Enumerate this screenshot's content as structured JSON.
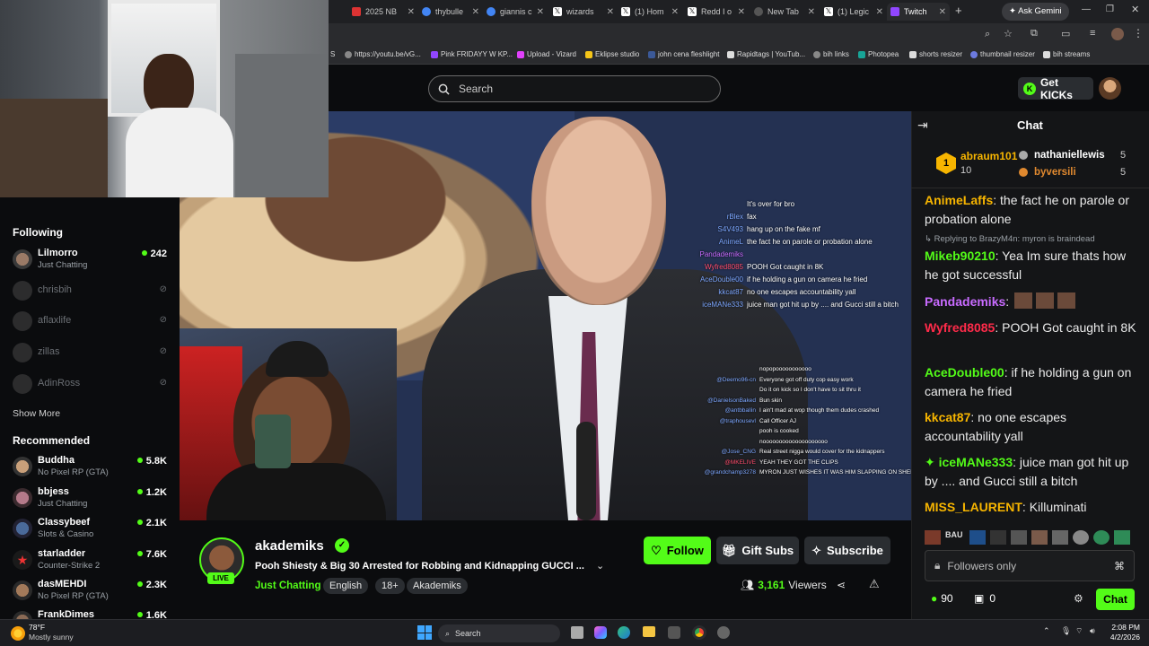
{
  "browser": {
    "tabs": [
      {
        "label": "2025 NB",
        "color": "#d33"
      },
      {
        "label": "thybulle",
        "color": "#4285f4"
      },
      {
        "label": "giannis c",
        "color": "#4285f4"
      },
      {
        "label": "wizards",
        "color": "#fff"
      },
      {
        "label": "(1) Hom",
        "color": "#fff"
      },
      {
        "label": "Redd I o",
        "color": "#fff"
      },
      {
        "label": "New Tab",
        "color": "#aaa"
      },
      {
        "label": "(1) Legic",
        "color": "#fff"
      },
      {
        "label": "Twitch",
        "color": "#9146ff"
      }
    ],
    "ask_gemini": "Ask Gemini",
    "bookmarks": [
      {
        "label": "S",
        "color": "#888"
      },
      {
        "label": "https://youtu.be/vG...",
        "color": "#888"
      },
      {
        "label": "Pink FRIDAYY W KP...",
        "color": "#9146ff"
      },
      {
        "label": "Upload - Vizard",
        "color": "#e040fb"
      },
      {
        "label": "Eklipse studio",
        "color": "#f5c518"
      },
      {
        "label": "john cena fleshlight",
        "color": "#3b5998"
      },
      {
        "label": "Rapidtags | YouTub...",
        "color": "#ddd"
      },
      {
        "label": "bih links",
        "color": "#888"
      },
      {
        "label": "Photopea",
        "color": "#18a497"
      },
      {
        "label": "shorts resizer",
        "color": "#ddd"
      },
      {
        "label": "thumbnail resizer",
        "color": "#6c7ae0"
      },
      {
        "label": "bih streams",
        "color": "#ddd"
      }
    ]
  },
  "header": {
    "search_placeholder": "Search",
    "get_kicks": "Get KICKs"
  },
  "sidebar": {
    "following_heading": "Following",
    "following": [
      {
        "name": "Lilmorro",
        "category": "Just Chatting",
        "viewers": "242",
        "live": true
      },
      {
        "name": "chrisbih",
        "live": false
      },
      {
        "name": "aflaxlife",
        "live": false
      },
      {
        "name": "zillas",
        "live": false
      },
      {
        "name": "AdinRoss",
        "live": false
      }
    ],
    "show_more": "Show More",
    "recommended_heading": "Recommended",
    "recommended": [
      {
        "name": "Buddha",
        "category": "No Pixel RP (GTA)",
        "viewers": "5.8K"
      },
      {
        "name": "bbjess",
        "category": "Just Chatting",
        "viewers": "1.2K"
      },
      {
        "name": "Classybeef",
        "category": "Slots & Casino",
        "viewers": "2.1K"
      },
      {
        "name": "starladder",
        "category": "Counter-Strike 2",
        "viewers": "7.6K"
      },
      {
        "name": "dasMEHDI",
        "category": "No Pixel RP (GTA)",
        "viewers": "2.3K"
      },
      {
        "name": "FrankDimes",
        "category": "",
        "viewers": "1.6K"
      }
    ]
  },
  "video_overlay_chat_top": [
    {
      "user": "",
      "text": "It's over for bro",
      "color": "#7da7ff"
    },
    {
      "user": "rBlex",
      "text": "fax",
      "color": "#7da7ff"
    },
    {
      "user": "S4V493",
      "text": "hang up on the fake mf",
      "color": "#7da7ff"
    },
    {
      "user": "AnimeL",
      "text": "the fact he on parole or probation alone",
      "color": "#7da7ff"
    },
    {
      "user": "Pandademiks",
      "text": "",
      "color": "#c86bff"
    },
    {
      "user": "Wyfred8085",
      "text": "POOH Got caught in 8K",
      "color": "#ff4d6d"
    },
    {
      "user": "AceDouble00",
      "text": "if he holding a gun on camera he fried",
      "color": "#7da7ff"
    },
    {
      "user": "kkcat87",
      "text": "no one escapes accountability yall",
      "color": "#7da7ff"
    },
    {
      "user": "iceMANe333",
      "text": "juice man got hit up by .... and Gucci still a bitch",
      "color": "#7da7ff"
    }
  ],
  "video_overlay_chat_bottom": [
    {
      "user": "",
      "text": "nopopooooooooooo",
      "color": "#c86bff"
    },
    {
      "user": "@Deemo96-cn",
      "text": "Everyone got off duty cop easy work",
      "color": "#7da7ff"
    },
    {
      "user": "",
      "text": "Do it on kick so I don't have to sit thru it",
      "color": "#7da7ff"
    },
    {
      "user": "@DanielsonBaked",
      "text": "Bun skin",
      "color": "#7da7ff"
    },
    {
      "user": "@antbballin",
      "text": "I ain't mad at wop though them dudes crashed",
      "color": "#7da7ff"
    },
    {
      "user": "@traphousevl",
      "text": "Call Officer AJ",
      "color": "#7da7ff"
    },
    {
      "user": "",
      "text": "pooh is cooked",
      "color": "#7da7ff"
    },
    {
      "user": "",
      "text": "noooooooooooooooooooo",
      "color": "#7da7ff"
    },
    {
      "user": "@Jose_CNG",
      "text": "Real street nigga would cover for the kidnappers",
      "color": "#7da7ff"
    },
    {
      "user": "@MKELIVE",
      "text": "YEAH THEY GOT THE CLIPS",
      "color": "#ff4d6d"
    },
    {
      "user": "@grandchamp3278",
      "text": "MYRON JUST WISHES IT WAS HIM SLAPPING ON SHEISTYS CUFFS!!!!",
      "color": "#7da7ff"
    }
  ],
  "stream": {
    "live_badge": "LIVE",
    "channel": "akademiks",
    "title": "Pooh Shiesty & Big 30 Arrested for Robbing and Kidnapping GUCCI ...",
    "category": "Just Chatting",
    "tags": [
      "English",
      "18+",
      "Akademiks"
    ],
    "follow": "Follow",
    "gift_subs": "Gift Subs",
    "subscribe": "Subscribe",
    "viewers": "3,161",
    "viewers_label": "Viewers"
  },
  "chat": {
    "title": "Chat",
    "gifters": [
      {
        "name": "abraum101",
        "count": "10",
        "rank": "1"
      },
      {
        "name": "nathaniellewis",
        "count": "5"
      },
      {
        "name": "byversili",
        "count": "5"
      }
    ],
    "messages": [
      {
        "user": "AnimeLaffs",
        "color": "#f7b500",
        "text": "the fact he on parole or probation alone"
      },
      {
        "reply": "Replying to BrazyM4n: myron is braindead"
      },
      {
        "user": "Mikeb90210",
        "color": "#53fc18",
        "text": "Yea Im sure thats how he got successful"
      },
      {
        "user": "Pandademiks",
        "color": "#c86bff",
        "text": ""
      },
      {
        "user": "Wyfred8085",
        "color": "#ff2b4a",
        "text": "POOH Got caught in 8K"
      },
      {
        "user": "AceDouble00",
        "color": "#53fc18",
        "text": "if he holding a gun on camera he fried"
      },
      {
        "user": "kkcat87",
        "color": "#f7b500",
        "text": "no one escapes accountability yall"
      },
      {
        "user": "iceMANe333",
        "color": "#53fc18",
        "text": "juice man got hit up by .... and Gucci still a bitch"
      },
      {
        "user": "MISS_LAURENT",
        "color": "#f7b500",
        "text": "Killuminati"
      }
    ],
    "input_placeholder": "Followers only",
    "points": "90",
    "gifts": "0",
    "send": "Chat"
  },
  "taskbar": {
    "weather_temp": "78°F",
    "weather_desc": "Mostly sunny",
    "search": "Search",
    "time": "2:08 PM",
    "date": "4/2/2026"
  }
}
